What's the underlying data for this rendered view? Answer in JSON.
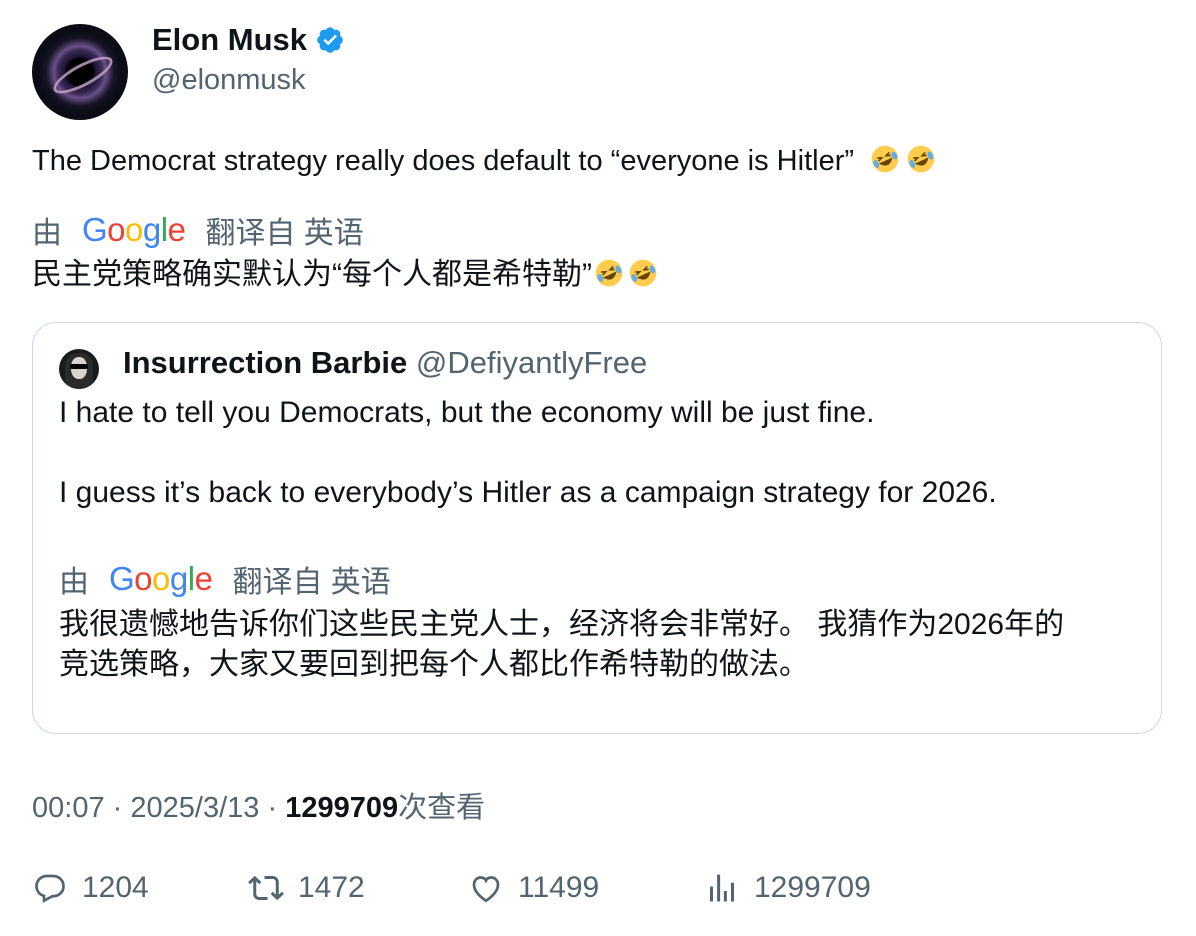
{
  "author": {
    "name": "Elon Musk",
    "handle": "@elonmusk",
    "verified": true
  },
  "tweet": {
    "text": "The Democrat strategy really does default to “everyone is Hitler”",
    "emoji": "rolling-on-floor-laughing x2",
    "translation_prefix": "由",
    "translation_provider": "Google",
    "translation_suffix": "翻译自 英语",
    "translated_text": "民主党策略确实默认为“每个人都是希特勒”"
  },
  "quoted": {
    "name": "Insurrection Barbie",
    "handle": "@DefiyantlyFree",
    "line1": "I hate to tell you Democrats, but the economy will be just fine.",
    "line2": "I guess it’s back to everybody’s Hitler as a campaign strategy for 2026.",
    "translation_prefix": "由",
    "translation_provider": "Google",
    "translation_suffix": "翻译自 英语",
    "translated_line1": "我很遗憾地告诉你们这些民主党人士，经济将会非常好。 我猜作为2026年的",
    "translated_line2": "竞选策略，大家又要回到把每个人都比作希特勒的做法。"
  },
  "meta": {
    "time": "00:07",
    "sep1": "·",
    "date": "2025/3/13",
    "sep2": "·",
    "views_count": "1299709",
    "views_label": "次查看"
  },
  "actions": {
    "replies": "1204",
    "retweets": "1472",
    "likes": "11499",
    "views": "1299709"
  },
  "colors": {
    "text": "#0f1419",
    "secondary": "#536471",
    "verified": "#1d9bf0",
    "border": "#cfd9de"
  }
}
